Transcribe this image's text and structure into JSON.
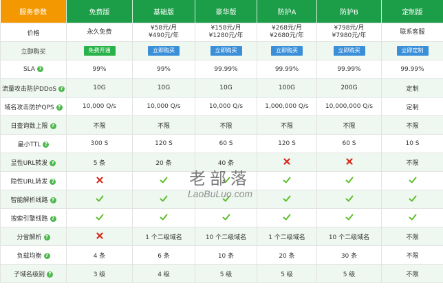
{
  "header": {
    "feature_col": "服务参数",
    "plans": [
      "免费版",
      "基础版",
      "豪华版",
      "防护A",
      "防护B",
      "定制版"
    ]
  },
  "pricing": {
    "label": "价格",
    "cells": [
      [
        "永久免费"
      ],
      [
        "¥58元/月",
        "¥490元/年"
      ],
      [
        "¥158元/月",
        "¥1280元/年"
      ],
      [
        "¥268元/月",
        "¥2680元/年"
      ],
      [
        "¥798元/月",
        "¥7980元/年"
      ],
      [
        "联系客服"
      ]
    ]
  },
  "buy": {
    "label": "立即购买",
    "buttons": [
      "免费开通",
      "立即购买",
      "立即购买",
      "立即购买",
      "立即购买",
      "立即定制"
    ]
  },
  "features": [
    {
      "label": "SLA",
      "help": true,
      "cells": [
        "99%",
        "99%",
        "99.99%",
        "99.99%",
        "99.99%",
        "99.99%"
      ]
    },
    {
      "label": "流量攻击防护DDoS",
      "help": true,
      "cells": [
        "10G",
        "10G",
        "10G",
        "100G",
        "200G",
        "定制"
      ]
    },
    {
      "label": "域名攻击防护QPS",
      "help": true,
      "cells": [
        "10,000 Q/s",
        "10,000 Q/s",
        "10,000 Q/s",
        "1,000,000 Q/s",
        "10,000,000 Q/s",
        "定制"
      ]
    },
    {
      "label": "日查询数上限",
      "help": true,
      "cells": [
        "不限",
        "不限",
        "不限",
        "不限",
        "不限",
        "不限"
      ]
    },
    {
      "label": "最小TTL",
      "help": true,
      "cells": [
        "300 S",
        "120 S",
        "60 S",
        "120 S",
        "60 S",
        "10 S"
      ]
    },
    {
      "label": "显性URL转发",
      "help": true,
      "cells": [
        "5 条",
        "20 条",
        "40 条",
        "x",
        "x",
        "不限"
      ]
    },
    {
      "label": "隐性URL转发",
      "help": true,
      "cells": [
        "x",
        "v",
        "v",
        "v",
        "v",
        "v"
      ]
    },
    {
      "label": "智能解析线路",
      "help": true,
      "cells": [
        "v",
        "v",
        "v",
        "v",
        "v",
        "v"
      ]
    },
    {
      "label": "搜索引擎线路",
      "help": true,
      "cells": [
        "v",
        "v",
        "v",
        "v",
        "v",
        "v"
      ]
    },
    {
      "label": "分省解析",
      "help": true,
      "cells": [
        "x",
        "1 个二级域名",
        "10 个二级域名",
        "1 个二级域名",
        "10 个二级域名",
        "不限"
      ]
    },
    {
      "label": "负载均衡",
      "help": true,
      "cells": [
        "4 条",
        "6 条",
        "10 条",
        "20 条",
        "30 条",
        "不限"
      ]
    },
    {
      "label": "子域名级别",
      "help": true,
      "cells": [
        "3 级",
        "4 级",
        "5 级",
        "5 级",
        "5 级",
        "不限"
      ]
    }
  ],
  "watermark": {
    "cn": "老部落",
    "en": "LaoBuLuo.com"
  },
  "colors": {
    "header_first": "#f39800",
    "header_plan": "#1c9e48",
    "check": "#5cbf2a",
    "cross": "#d9291c",
    "button_green": "#2ab24a",
    "button_blue": "#3a8fd8",
    "row_alt": "#eef7f0"
  }
}
